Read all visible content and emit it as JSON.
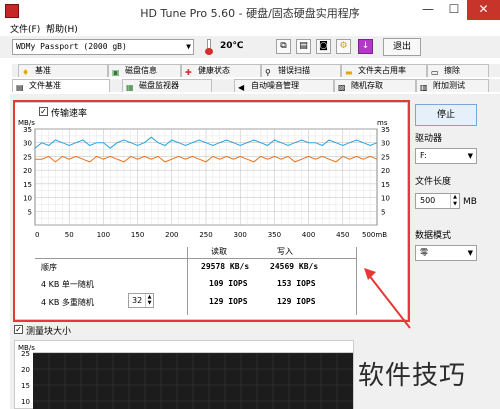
{
  "window": {
    "title": "HD Tune Pro 5.60 - 硬盘/固态硬盘实用程序",
    "minimize": "—",
    "maximize": "☐",
    "close": "✕"
  },
  "menu": [
    "文件(F)",
    "帮助(H)"
  ],
  "toolbar": {
    "drive": "WDMy Passport (2000 gB)",
    "temperature": "20℃",
    "exit_label": "退出",
    "icons": [
      "copy-icon",
      "copy-all-icon",
      "camera-icon",
      "options-icon",
      "download-icon"
    ]
  },
  "tabs_top": [
    {
      "label": "基准",
      "icon": "benchmark-icon"
    },
    {
      "label": "磁盘信息",
      "icon": "disk-info-icon"
    },
    {
      "label": "健康状态",
      "icon": "health-icon"
    },
    {
      "label": "错误扫描",
      "icon": "error-scan-icon"
    },
    {
      "label": "文件夹占用率",
      "icon": "folder-icon"
    },
    {
      "label": "擦除",
      "icon": "erase-icon"
    }
  ],
  "tabs_bottom": [
    {
      "label": "文件基准",
      "icon": "file-benchmark-icon"
    },
    {
      "label": "磁盘监视器",
      "icon": "disk-monitor-icon"
    },
    {
      "label": "自动噪音管理",
      "icon": "noise-icon"
    },
    {
      "label": "随机存取",
      "icon": "random-access-icon"
    },
    {
      "label": "附加测试",
      "icon": "extra-tests-icon"
    }
  ],
  "transfer": {
    "checkbox_label": "传输速率",
    "checked": true
  },
  "chart_data": {
    "type": "line",
    "y_unit_left": "MB/s",
    "y_unit_right": "ms",
    "y_ticks": [
      "35",
      "30",
      "25",
      "20",
      "15",
      "10",
      "5"
    ],
    "y_ticks_right": [
      "35",
      "30",
      "25",
      "20",
      "15",
      "10",
      "5"
    ],
    "ylim": [
      0,
      35
    ],
    "x_ticks": [
      "0",
      "50",
      "100",
      "150",
      "200",
      "250",
      "300",
      "350",
      "400",
      "450",
      "500mB"
    ],
    "xlim": [
      0,
      500
    ],
    "grid": true,
    "series": [
      {
        "name": "读取",
        "color": "#29a3e0",
        "x": [
          0,
          10,
          20,
          30,
          40,
          50,
          60,
          70,
          80,
          90,
          100,
          110,
          120,
          130,
          140,
          150,
          160,
          170,
          180,
          190,
          200,
          210,
          220,
          230,
          240,
          250,
          260,
          270,
          280,
          290,
          300,
          310,
          320,
          330,
          340,
          350,
          360,
          370,
          380,
          390,
          400,
          410,
          420,
          430,
          440,
          450,
          460,
          470,
          480,
          490,
          500
        ],
        "values": [
          28,
          30,
          29,
          31,
          30,
          29,
          30,
          31,
          29,
          30,
          30,
          28,
          30,
          31,
          30,
          29,
          30,
          32,
          30,
          29,
          31,
          30,
          29,
          30,
          31,
          30,
          29,
          30,
          31,
          30,
          29,
          30,
          31,
          30,
          29,
          31,
          30,
          29,
          30,
          31,
          30,
          30,
          29,
          31,
          30,
          29,
          30,
          31,
          30,
          29,
          30
        ]
      },
      {
        "name": "写入",
        "color": "#e8721c",
        "x": [
          0,
          10,
          20,
          30,
          40,
          50,
          60,
          70,
          80,
          90,
          100,
          110,
          120,
          130,
          140,
          150,
          160,
          170,
          180,
          190,
          200,
          210,
          220,
          230,
          240,
          250,
          260,
          270,
          280,
          290,
          300,
          310,
          320,
          330,
          340,
          350,
          360,
          370,
          380,
          390,
          400,
          410,
          420,
          430,
          440,
          450,
          460,
          470,
          480,
          490,
          500
        ],
        "values": [
          24,
          24,
          25,
          23,
          25,
          24,
          25,
          24,
          23,
          25,
          24,
          25,
          24,
          23,
          25,
          24,
          25,
          24,
          25,
          23,
          24,
          25,
          24,
          25,
          24,
          23,
          25,
          24,
          25,
          24,
          25,
          24,
          23,
          25,
          24,
          25,
          24,
          25,
          23,
          24,
          25,
          24,
          25,
          24,
          23,
          25,
          24,
          25,
          24,
          25,
          24
        ]
      }
    ]
  },
  "results": {
    "col_read": "读取",
    "col_write": "写入",
    "rows": [
      {
        "label": "顺序",
        "read": "29578 KB/s",
        "write": "24569 KB/s"
      },
      {
        "label": "4 KB 单一随机",
        "read": "109 IOPS",
        "write": "153 IOPS"
      },
      {
        "label": "4 KB 多重随机",
        "read": "129 IOPS",
        "write": "129 IOPS"
      }
    ],
    "queue_depth": "32"
  },
  "side": {
    "stop_label": "停止",
    "drive_label": "驱动器",
    "drive_value": "F:",
    "file_length_label": "文件长度",
    "file_length_value": "500",
    "file_length_unit": "MB",
    "data_mode_label": "数据模式",
    "data_mode_value": "零"
  },
  "block_size": {
    "checkbox_label": "测量块大小",
    "checked": true,
    "y_unit": "MB/s",
    "y_ticks": [
      "25",
      "20",
      "15",
      "10"
    ]
  },
  "watermark": "软件技巧"
}
